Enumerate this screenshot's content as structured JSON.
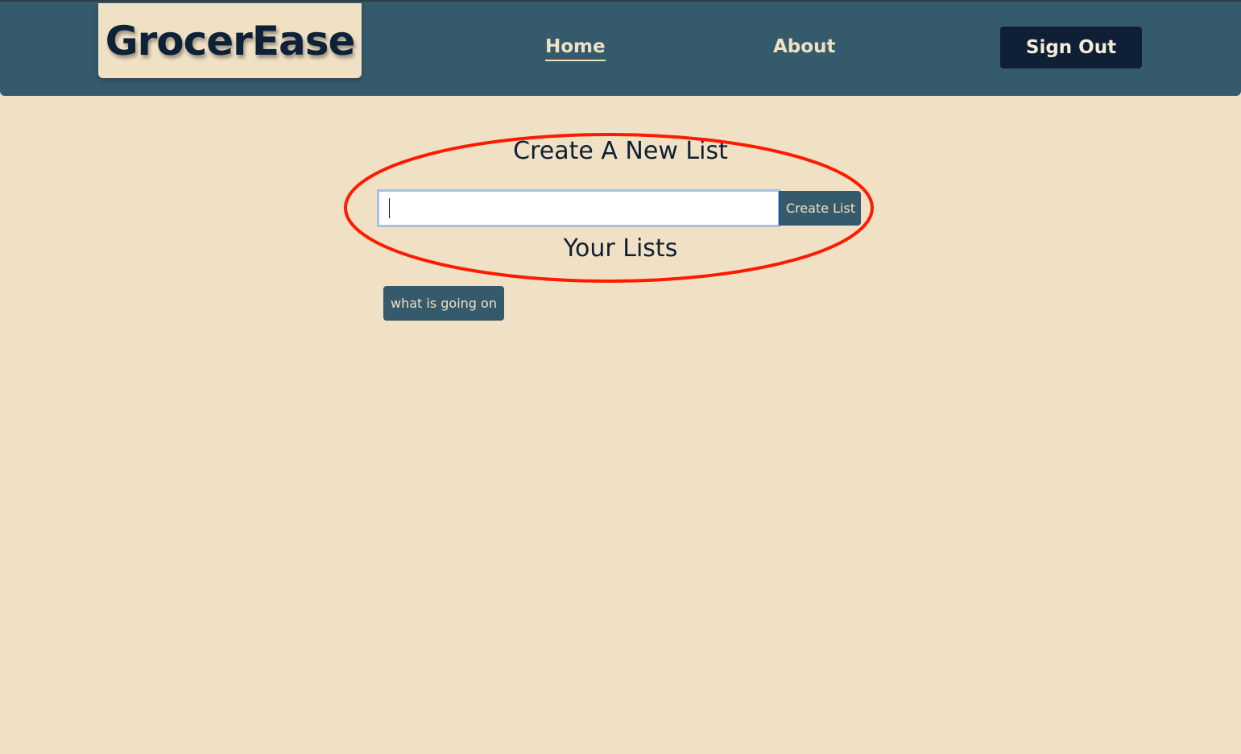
{
  "header": {
    "logo_text": "GrocerEase",
    "nav": {
      "home": "Home",
      "about": "About"
    },
    "signout_label": "Sign Out"
  },
  "main": {
    "create_title": "Create A New List",
    "input_value": "",
    "create_button_label": "Create List",
    "lists_title": "Your Lists",
    "lists": [
      "what is going on"
    ]
  },
  "colors": {
    "nav_bg": "#355a6c",
    "page_bg": "#f0e1c4",
    "dark": "#0e1f36",
    "annotation": "#ff1a00"
  }
}
